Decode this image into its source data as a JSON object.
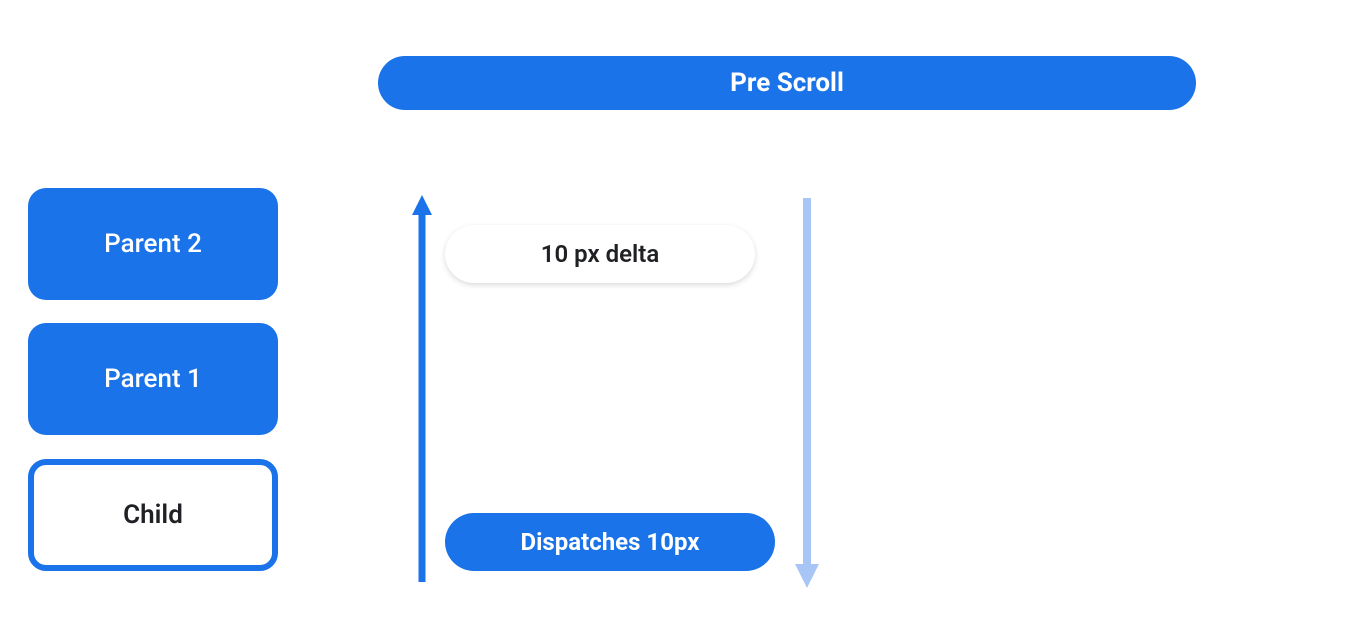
{
  "header": {
    "title": "Pre Scroll"
  },
  "nodes": {
    "parent2": "Parent 2",
    "parent1": "Parent 1",
    "child": "Child"
  },
  "tags": {
    "delta": "10 px delta",
    "dispatch": "Dispatches 10px"
  },
  "colors": {
    "primary": "#1a73e8",
    "light": "#a8c6f5"
  }
}
